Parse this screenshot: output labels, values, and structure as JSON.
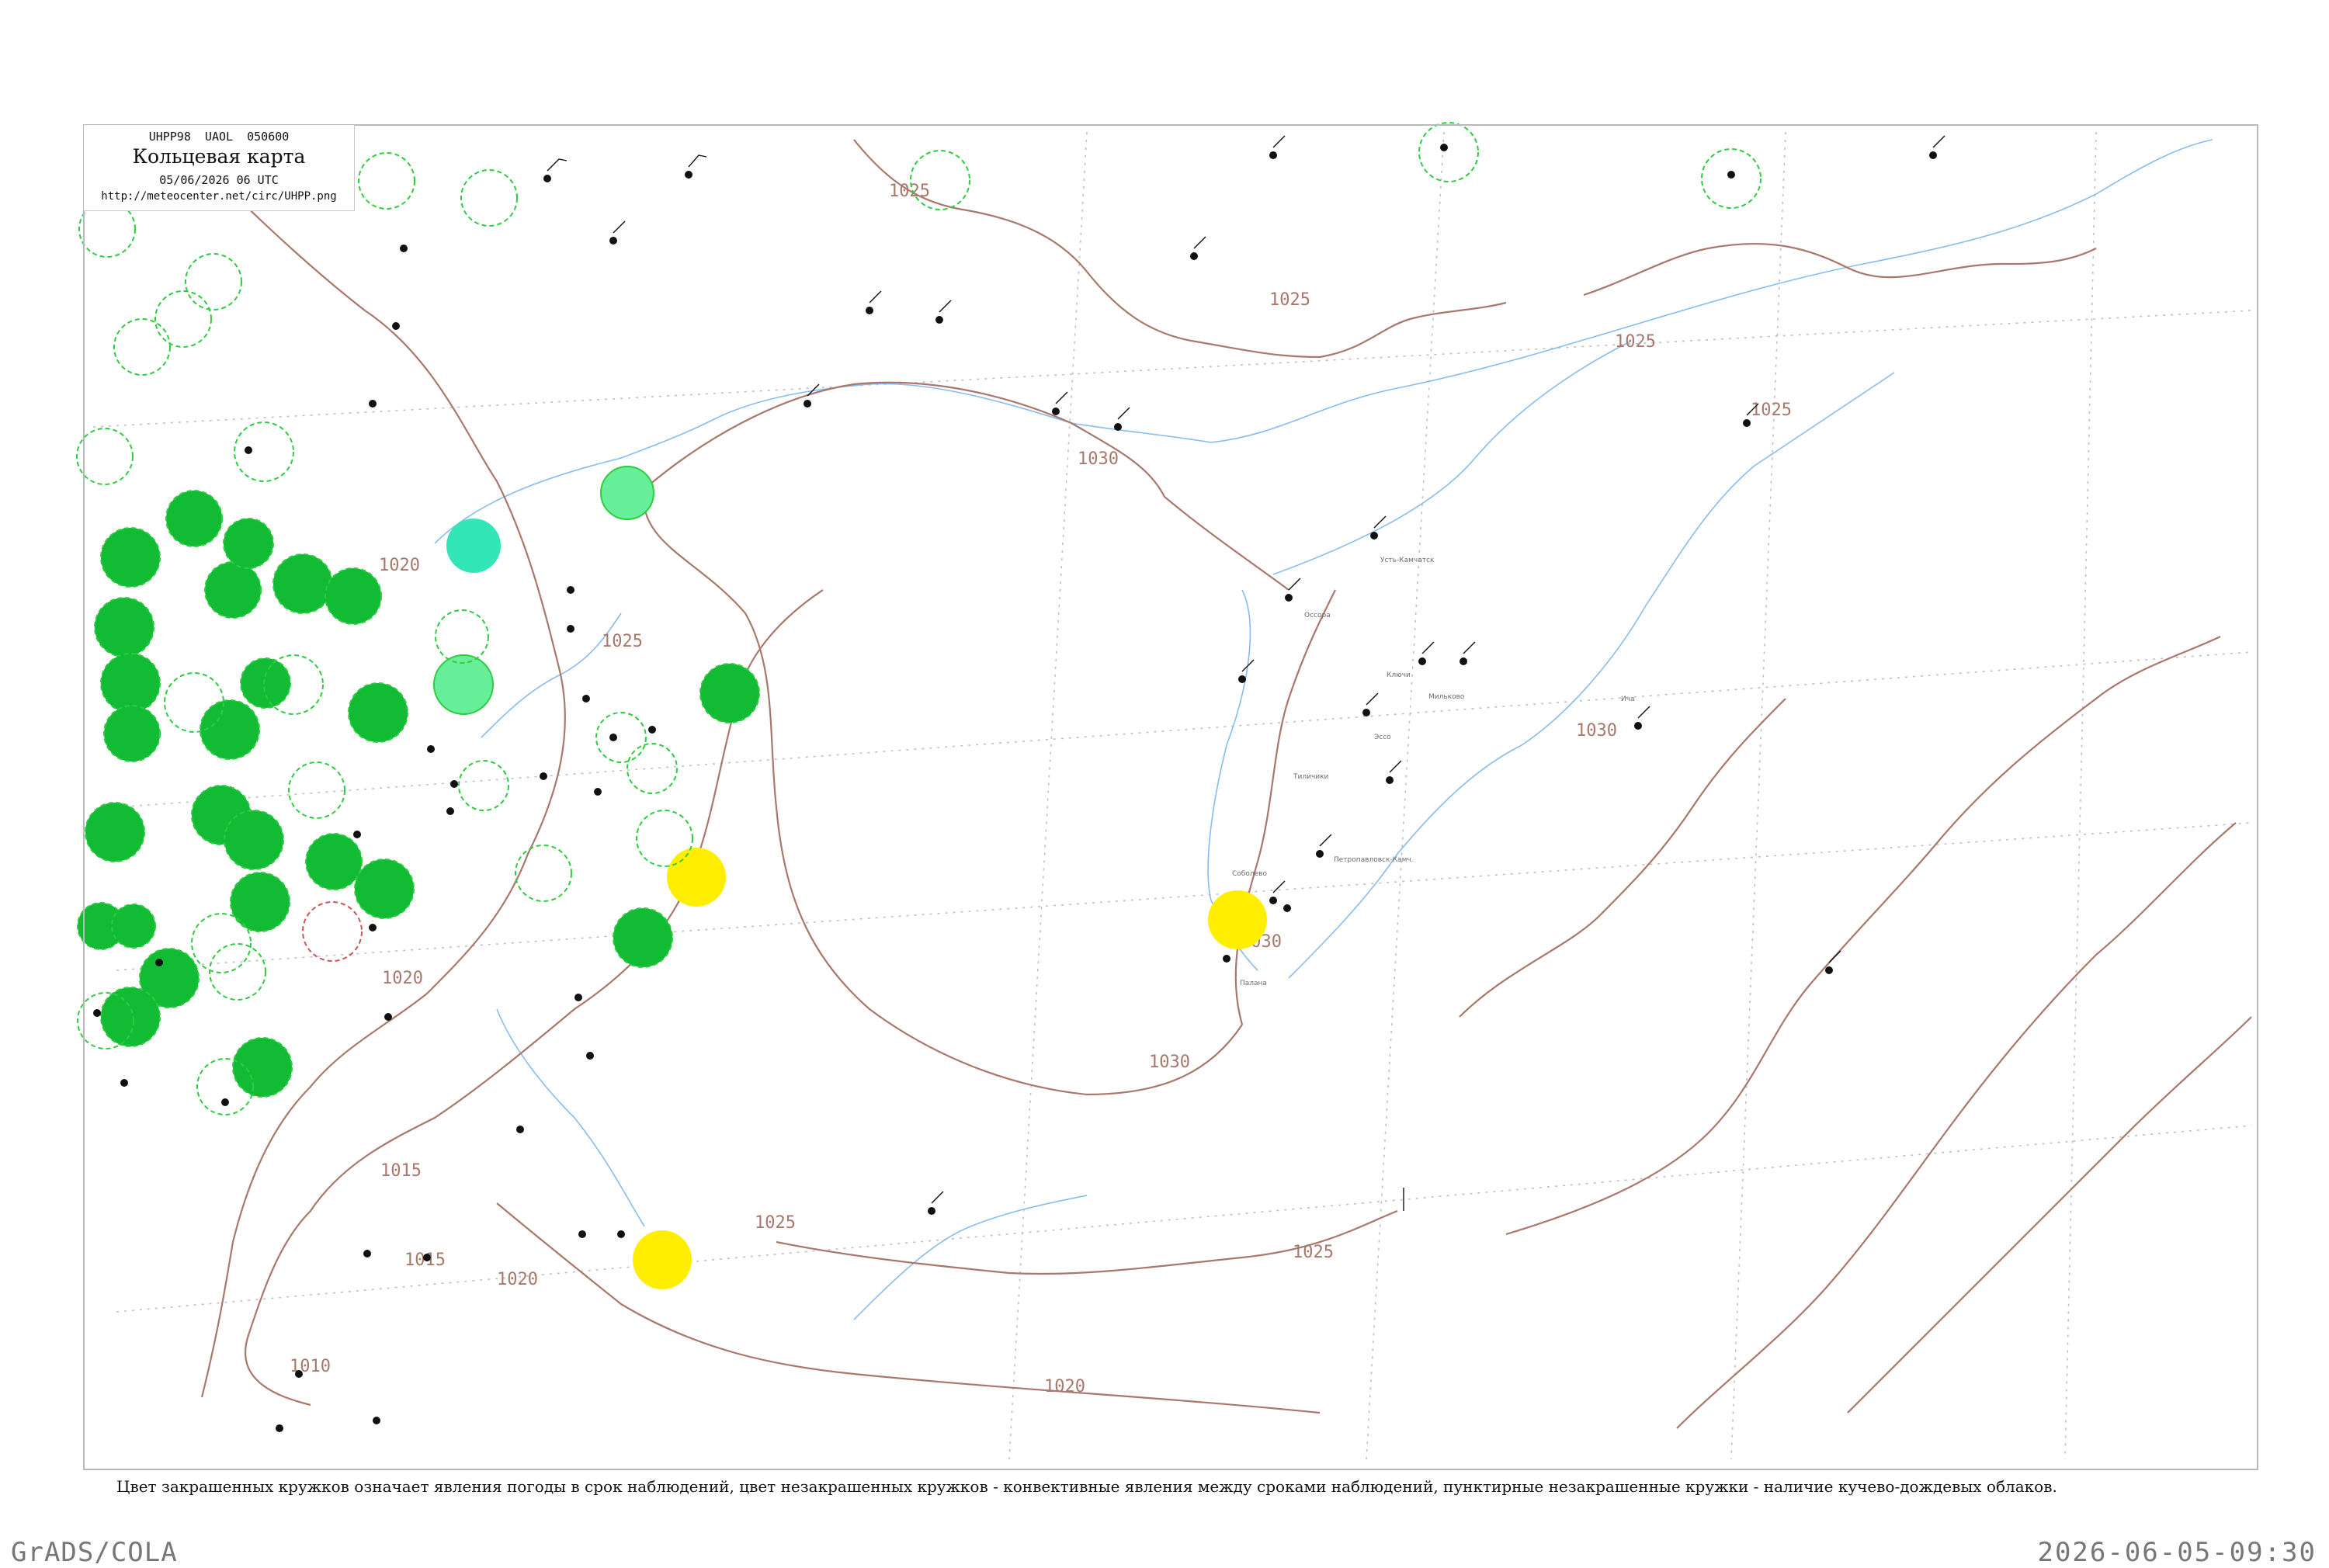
{
  "header": {
    "code": "UHPP98  UAOL  050600",
    "title": "Кольцевая карта",
    "datetime": "05/06/2026 06 UTC",
    "url": "http://meteocenter.net/circ/UHPP.png"
  },
  "isobars": {
    "labels": [
      "1025",
      "1025",
      "1025",
      "1025",
      "1030",
      "1030",
      "1030",
      "1030",
      "1025",
      "1020",
      "1020",
      "1020",
      "1015",
      "1015",
      "1010",
      "1025",
      "1025",
      "1020"
    ]
  },
  "stations": [
    {
      "name": "Усть-Камчатск"
    },
    {
      "name": "Мильково"
    },
    {
      "name": "Петропавловск-Камч."
    },
    {
      "name": "Ключи"
    },
    {
      "name": "Оссора"
    },
    {
      "name": "Тиличики"
    },
    {
      "name": "Палана"
    },
    {
      "name": "Ича"
    },
    {
      "name": "Соболево"
    },
    {
      "name": "Эссо"
    }
  ],
  "legend": {
    "text": "Цвет закрашенных кружков означает явления погоды в срок наблюдений, цвет незакрашенных кружков - конвективные явления между сроками наблюдений, пунктирные незакрашенные кружки - наличие кучево-дождевых облаков."
  },
  "footer": {
    "left": "GrADS/COLA",
    "right": "2026-06-05-09:30"
  },
  "colors": {
    "isobar": "#a9786c",
    "coastline": "#86bcf0",
    "frame": "#b9b9b9",
    "rain_fill": "#11bb33",
    "cb_dashed": "#2ecc40",
    "fog_fill": "#ffee00",
    "shower_fill": "#33e6b8",
    "light_green": "#66ee99"
  }
}
